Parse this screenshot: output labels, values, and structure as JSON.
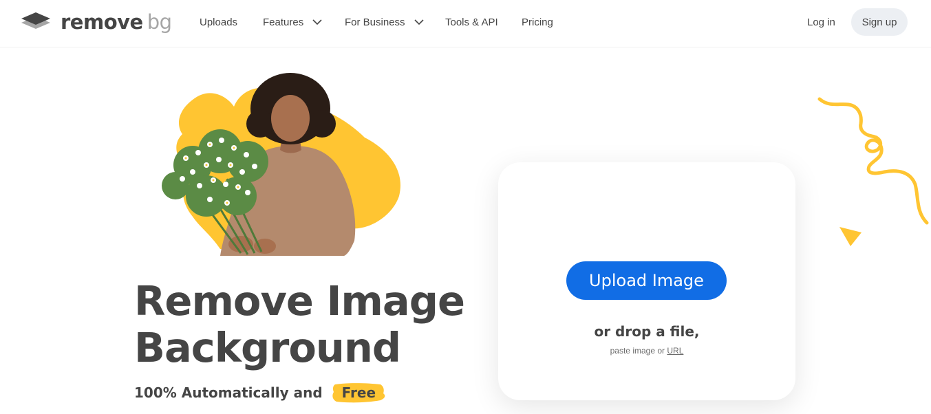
{
  "header": {
    "logo": {
      "word1": "remove",
      "word2": "bg"
    },
    "nav": [
      {
        "label": "Uploads",
        "dropdown": false
      },
      {
        "label": "Features",
        "dropdown": true
      },
      {
        "label": "For Business",
        "dropdown": true
      },
      {
        "label": "Tools & API",
        "dropdown": false
      },
      {
        "label": "Pricing",
        "dropdown": false
      }
    ],
    "login_label": "Log in",
    "signup_label": "Sign up"
  },
  "hero": {
    "headline_line1": "Remove Image",
    "headline_line2": "Background",
    "sub_prefix": "100% Automatically and",
    "sub_highlight": "Free"
  },
  "upload": {
    "button_label": "Upload Image",
    "drop_text": "or drop a file,",
    "paste_text": "paste image or",
    "url_link": "URL"
  },
  "colors": {
    "primary": "#116de5",
    "accent_yellow": "#ffc532",
    "text": "#454545",
    "muted": "#a6a6a6",
    "signup_bg": "#eceff3"
  },
  "icons": {
    "logo": "layers-logo-icon",
    "dropdown": "chevron-down-icon"
  }
}
